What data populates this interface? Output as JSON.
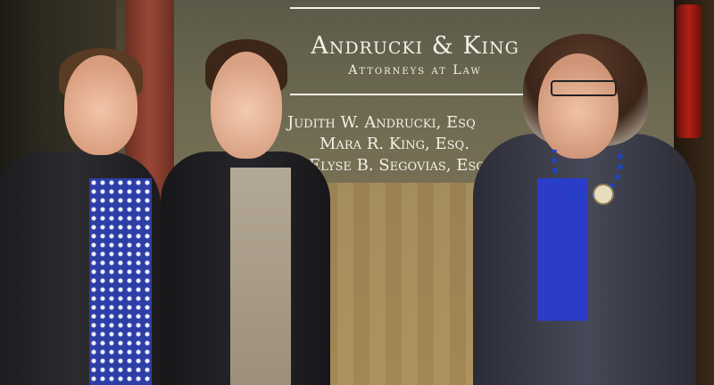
{
  "sign": {
    "firm_name": "Andrucki & King",
    "firm_subtitle": "Attorneys at Law",
    "attorneys": [
      "Judith W. Andrucki, Esq",
      "Mara R. King, Esq.",
      "Elyse B. Segovias, Esq"
    ]
  }
}
